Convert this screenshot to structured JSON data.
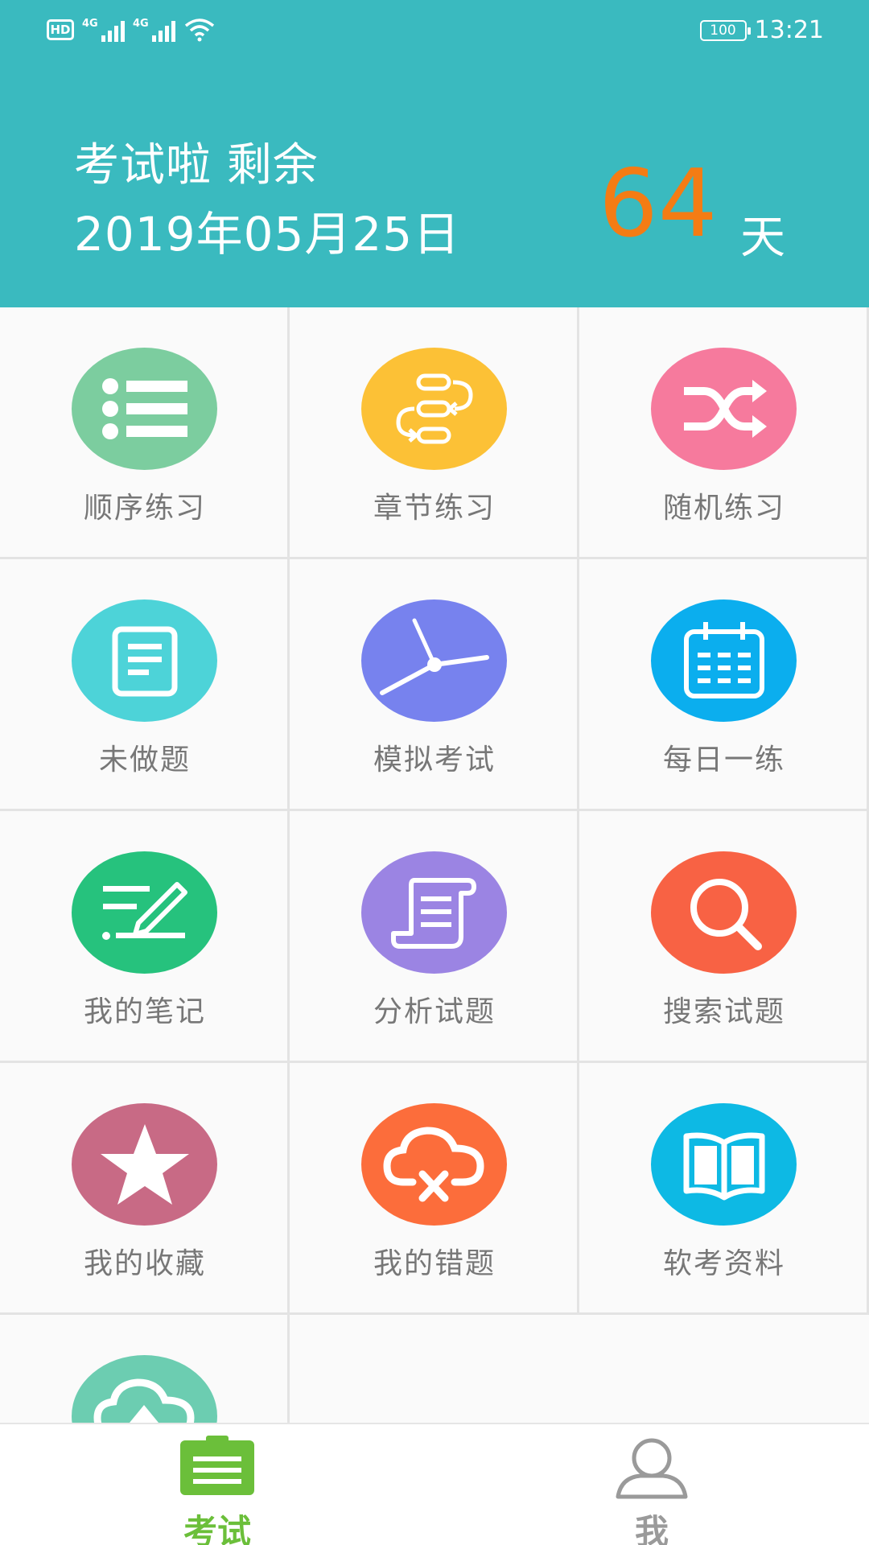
{
  "status_bar": {
    "hd": "HD",
    "net1": "4G",
    "net2": "4G",
    "battery": "100",
    "time": "13:21"
  },
  "header": {
    "line1": "考试啦 剩余",
    "date": "2019年05月25日",
    "days": "64",
    "days_unit": "天",
    "accent_color": "#f47c14",
    "bg_color": "#3ababf"
  },
  "grid": {
    "items": [
      {
        "label": "顺序练习",
        "icon": "list-icon",
        "color": "#7ccd9f"
      },
      {
        "label": "章节练习",
        "icon": "flow-icon",
        "color": "#fcc136"
      },
      {
        "label": "随机练习",
        "icon": "shuffle-icon",
        "color": "#f67a9d"
      },
      {
        "label": "未做题",
        "icon": "document-icon",
        "color": "#4dd3d8"
      },
      {
        "label": "模拟考试",
        "icon": "clock-icon",
        "color": "#7782ee"
      },
      {
        "label": "每日一练",
        "icon": "calendar-icon",
        "color": "#0baeee"
      },
      {
        "label": "我的笔记",
        "icon": "note-pen-icon",
        "color": "#26c27d"
      },
      {
        "label": "分析试题",
        "icon": "scroll-icon",
        "color": "#9b84e3"
      },
      {
        "label": "搜索试题",
        "icon": "search-icon",
        "color": "#f86244"
      },
      {
        "label": "我的收藏",
        "icon": "star-icon",
        "color": "#c86a85"
      },
      {
        "label": "我的错题",
        "icon": "cloud-x-icon",
        "color": "#fc6d3b"
      },
      {
        "label": "软考资料",
        "icon": "book-icon",
        "color": "#0db9e4"
      },
      {
        "label": "",
        "icon": "cloud-upload-icon",
        "color": "#6ccdb1"
      }
    ]
  },
  "bottom_nav": {
    "tabs": [
      {
        "label": "考试",
        "icon": "clipboard-icon",
        "active": true,
        "color": "#6bbf3a"
      },
      {
        "label": "我",
        "icon": "person-icon",
        "active": false,
        "color": "#9a9a9a"
      }
    ]
  }
}
